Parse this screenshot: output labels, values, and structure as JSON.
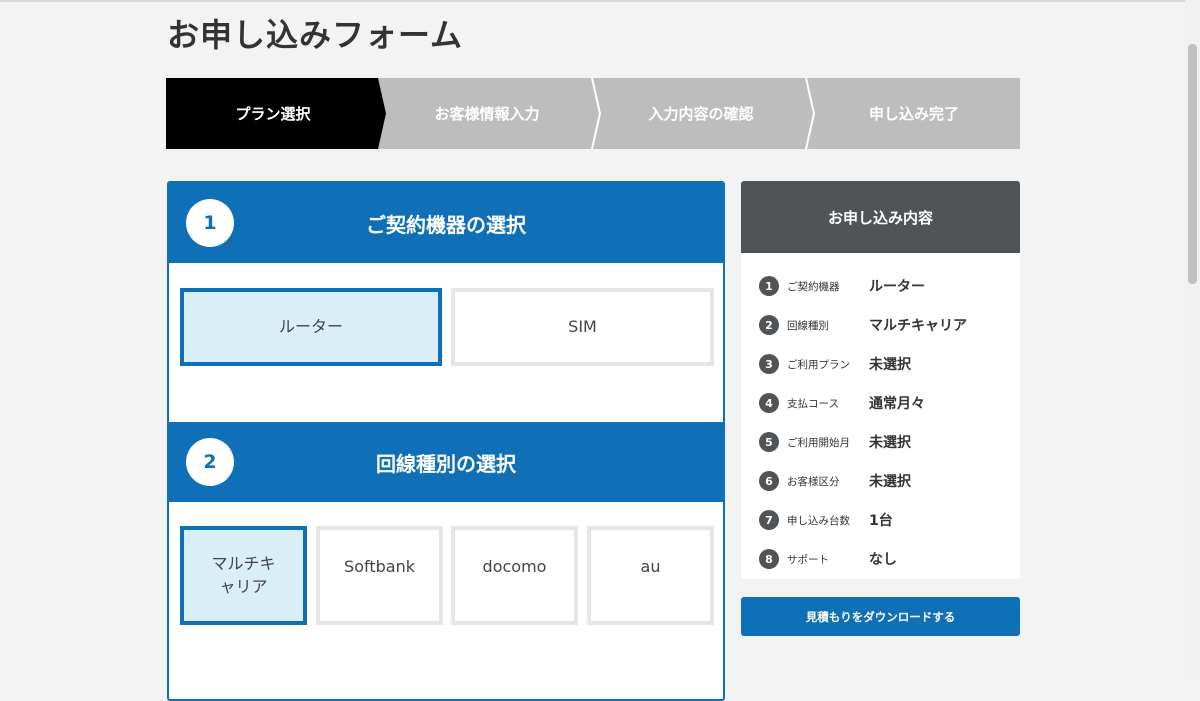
{
  "page": {
    "title": "お申し込みフォーム"
  },
  "steps": [
    {
      "label": "プラン選択",
      "active": true
    },
    {
      "label": "お客様情報入力",
      "active": false
    },
    {
      "label": "入力内容の確認",
      "active": false
    },
    {
      "label": "申し込み完了",
      "active": false
    }
  ],
  "sections": [
    {
      "number": "1",
      "title": "ご契約機器の選択",
      "options": [
        {
          "label": "ルーター",
          "selected": true
        },
        {
          "label": "SIM",
          "selected": false
        }
      ]
    },
    {
      "number": "2",
      "title": "回線種別の選択",
      "options": [
        {
          "label": "マルチキャリア",
          "line1": "マルチキ",
          "line2": "ャリア",
          "selected": true
        },
        {
          "label": "Softbank",
          "selected": false
        },
        {
          "label": "docomo",
          "selected": false
        },
        {
          "label": "au",
          "selected": false
        }
      ]
    }
  ],
  "summary": {
    "title": "お申し込み内容",
    "rows": [
      {
        "num": "1",
        "label": "ご契約機器",
        "value": "ルーター"
      },
      {
        "num": "2",
        "label": "回線種別",
        "value": "マルチキャリア"
      },
      {
        "num": "3",
        "label": "ご利用プラン",
        "value": "未選択"
      },
      {
        "num": "4",
        "label": "支払コース",
        "value": "通常月々"
      },
      {
        "num": "5",
        "label": "ご利用開始月",
        "value": "未選択"
      },
      {
        "num": "6",
        "label": "お客様区分",
        "value": "未選択"
      },
      {
        "num": "7",
        "label": "申し込み台数",
        "value": "1台"
      },
      {
        "num": "8",
        "label": "サポート",
        "value": "なし"
      }
    ]
  },
  "download_button": {
    "label": "見積もりをダウンロードする"
  },
  "colors": {
    "primary": "#0f70b7",
    "active_step": "#000000",
    "inactive_step": "#bdbdbd",
    "summary_head": "#505456",
    "selected_bg": "#d9eef6"
  }
}
